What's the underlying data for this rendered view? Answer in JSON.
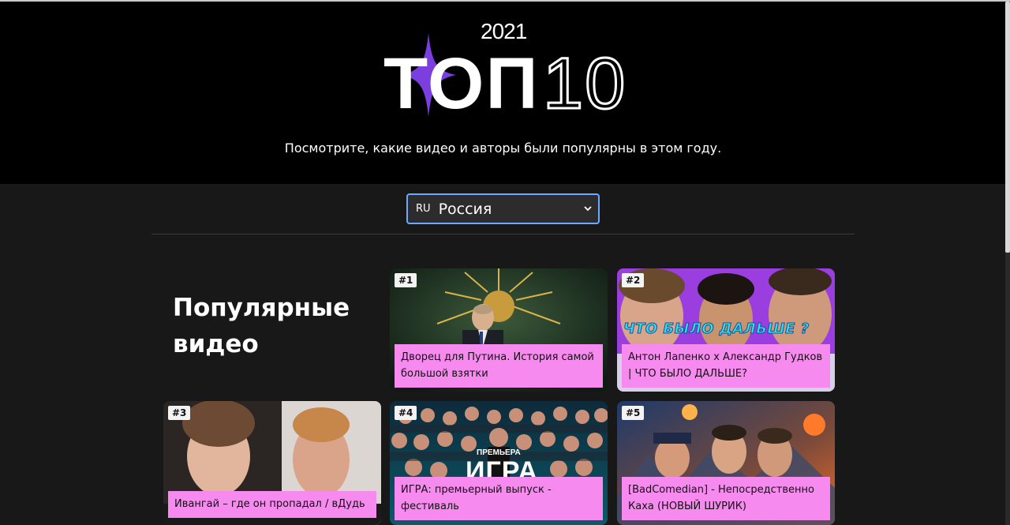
{
  "hero": {
    "year": "2021",
    "title": "ТОП",
    "title_number": "10",
    "subtitle": "Посмотрите, какие видео и авторы были популярны в этом году."
  },
  "country_select": {
    "code": "RU",
    "selected": "Россия"
  },
  "section": {
    "title_line1": "Популярные",
    "title_line2": "видео"
  },
  "videos": [
    {
      "rank": "#1",
      "title": "Дворец для Путина. История самой большой взятки"
    },
    {
      "rank": "#2",
      "title": "Антон Лапенко х Александр Гудков | ЧТО БЫЛО ДАЛЬШЕ?",
      "thumb_caption": "ЧТО БЫЛО ДАЛЬШЕ ?"
    },
    {
      "rank": "#3",
      "title": "Ивангай – где он пропадал / вДудь"
    },
    {
      "rank": "#4",
      "title": "ИГРА: премьерный выпуск - фестиваль",
      "thumb_caption_small": "ПРЕМЬЕРА",
      "thumb_caption_big": "ИГРА"
    },
    {
      "rank": "#5",
      "title": "[BadComedian] - Непосредственно Каха (НОВЫЙ ШУРИК)"
    }
  ],
  "colors": {
    "accent_purple": "#7b3fe0",
    "title_bg": "#f78aef",
    "select_border": "#6fa8ff"
  }
}
